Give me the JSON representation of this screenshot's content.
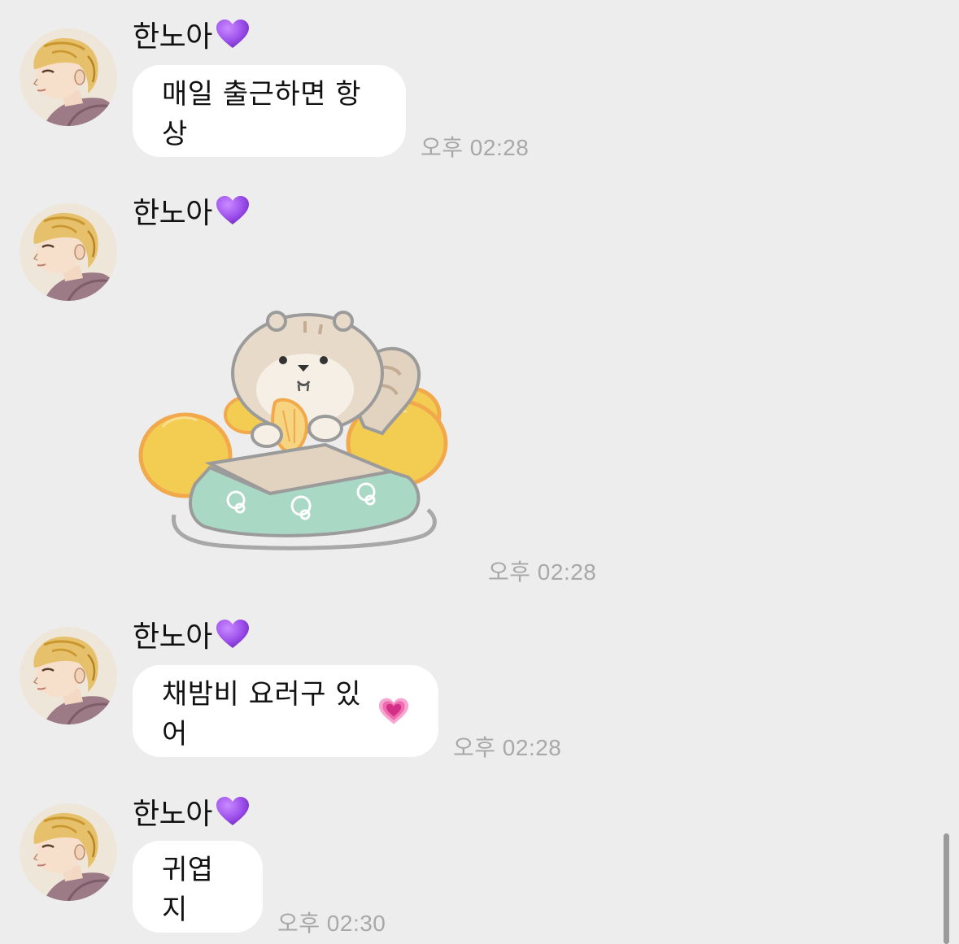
{
  "messages": [
    {
      "sender": "한노아",
      "sender_badge": "purple-heart-emoji",
      "text": "매일 출근하면 항상",
      "time": "오후 02:28"
    },
    {
      "sender": "한노아",
      "sender_badge": "purple-heart-emoji",
      "sticker": "squirrel-eating-tangerine-sticker",
      "time": "오후 02:28"
    },
    {
      "sender": "한노아",
      "sender_badge": "purple-heart-emoji",
      "text": "채밤비 요러구 있어",
      "text_emoji": "growing-pink-heart-emoji",
      "time": "오후 02:28"
    },
    {
      "sender": "한노아",
      "sender_badge": "purple-heart-emoji",
      "text": "귀엽지",
      "time": "오후 02:30"
    }
  ],
  "colors": {
    "background": "#ededed",
    "bubble": "#ffffff",
    "time_text": "#a8a8a8",
    "purple_heart": "#9b4dea",
    "pink_heart": "#e8459a"
  }
}
